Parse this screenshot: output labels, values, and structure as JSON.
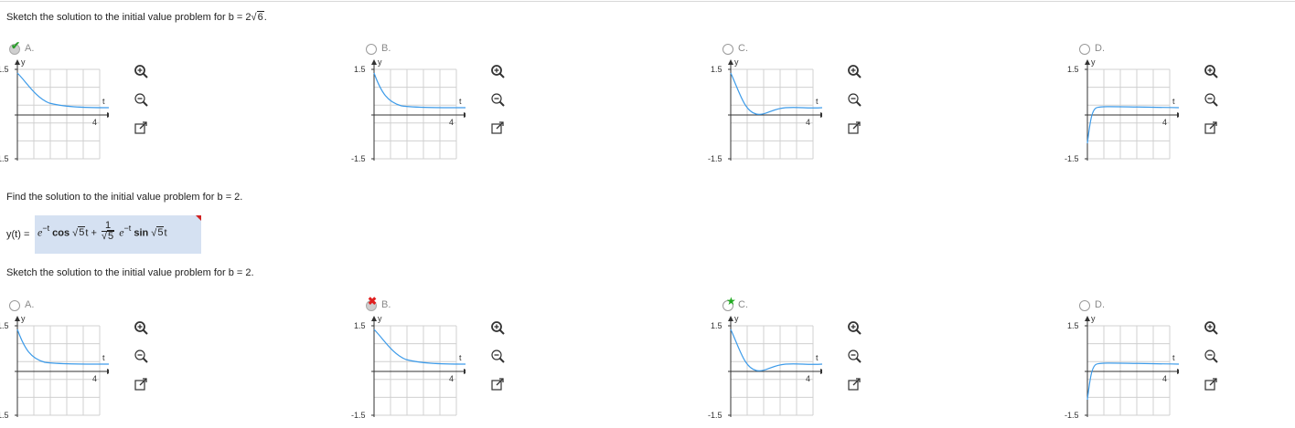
{
  "questions": {
    "q1": {
      "prefix": "Sketch the solution to the initial value problem for b = 2",
      "radicand": "6",
      "suffix": "."
    },
    "q2": "Find the solution to the initial value problem for b = 2.",
    "q3": "Sketch the solution to the initial value problem for b = 2."
  },
  "answer": {
    "lhs": "y(t) =",
    "e": "e",
    "exp": "−t",
    "cos": "cos",
    "sqrt5": "5",
    "t1": "t +",
    "frac_num": "1",
    "sin": "sin",
    "t2": "t"
  },
  "graph_labels": {
    "y": "y",
    "t": "t",
    "y_top": "1.5",
    "y_bottom": "-1.5",
    "x_tick": "4"
  },
  "colors": {
    "curve": "#3d9be9",
    "grid": "#d0d0d0",
    "axis": "#333333",
    "correct": "#2e9e2e",
    "wrong": "#e02020"
  },
  "group1": {
    "options": [
      {
        "label": "A.",
        "state": "selected-correct",
        "curve": "decay"
      },
      {
        "label": "B.",
        "state": "unselected",
        "curve": "decay-fast"
      },
      {
        "label": "C.",
        "state": "unselected",
        "curve": "oscillate"
      },
      {
        "label": "D.",
        "state": "unselected",
        "curve": "rise"
      }
    ]
  },
  "group2": {
    "options": [
      {
        "label": "A.",
        "state": "unselected",
        "curve": "decay-fast"
      },
      {
        "label": "B.",
        "state": "selected-wrong",
        "curve": "decay"
      },
      {
        "label": "C.",
        "state": "correct-answer",
        "curve": "oscillate"
      },
      {
        "label": "D.",
        "state": "unselected",
        "curve": "rise"
      }
    ]
  },
  "tools": [
    "zoom-in-icon",
    "zoom-out-icon",
    "open-external-icon"
  ]
}
